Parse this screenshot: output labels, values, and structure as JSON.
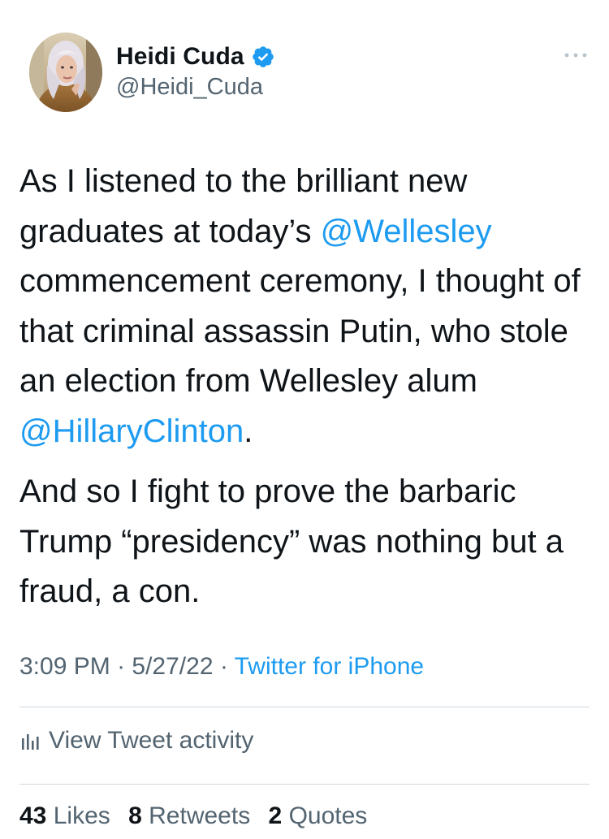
{
  "author": {
    "display_name": "Heidi Cuda",
    "handle": "@Heidi_Cuda",
    "verified": true
  },
  "tweet": {
    "paragraphs": [
      [
        {
          "text": "As I listened to the brilliant new graduates at today’s ",
          "mention": false
        },
        {
          "text": "@Wellesley",
          "mention": true
        },
        {
          "text": " commencement ceremony, I thought of that criminal assassin Putin, who stole an election from Wellesley alum ",
          "mention": false
        },
        {
          "text": "@HillaryClinton",
          "mention": true
        },
        {
          "text": ".",
          "mention": false
        }
      ],
      [
        {
          "text": "And so I fight to prove the barbaric Trump “presidency” was nothing but a fraud, a con.",
          "mention": false
        }
      ]
    ]
  },
  "meta": {
    "time": "3:09 PM",
    "separator": " · ",
    "date": "5/27/22",
    "source": "Twitter for iPhone"
  },
  "activity": {
    "label": "View Tweet activity",
    "icon": "bar-chart-icon"
  },
  "stats": [
    {
      "count": "43",
      "label": "Likes"
    },
    {
      "count": "8",
      "label": "Retweets"
    },
    {
      "count": "2",
      "label": "Quotes"
    }
  ],
  "colors": {
    "accent": "#1d9bf0",
    "text": "#0f1419",
    "muted": "#536471",
    "divider": "#cfd9de"
  }
}
